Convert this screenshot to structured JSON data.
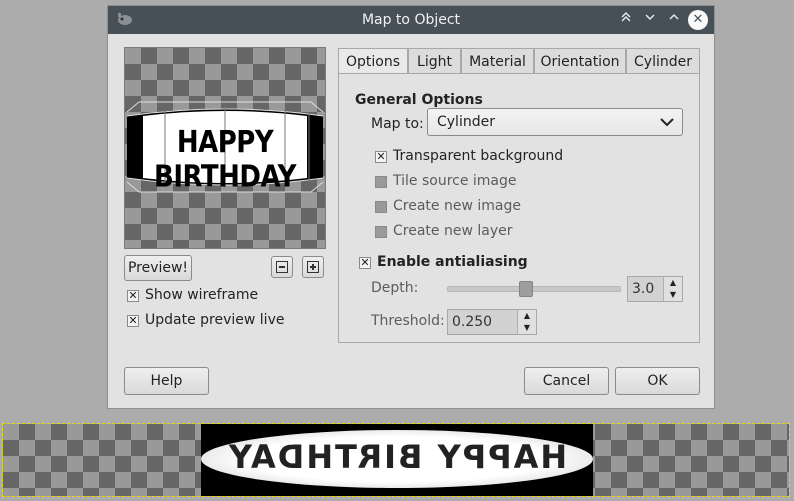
{
  "canvas": {
    "banner_text": "HAPPY BIRTHDAY"
  },
  "dialog": {
    "title": "Map to Object",
    "preview_text": "HAPPY BIRTHDAY",
    "preview_button": "Preview!",
    "show_wireframe": {
      "label": "Show wireframe",
      "checked": true
    },
    "update_preview_live": {
      "label": "Update preview live",
      "checked": true
    },
    "tabs": [
      "Options",
      "Light",
      "Material",
      "Orientation",
      "Cylinder"
    ],
    "active_tab": "Options",
    "options": {
      "section_title": "General Options",
      "map_to_label": "Map to:",
      "map_to_value": "Cylinder",
      "transparent_background": {
        "label": "Transparent background",
        "checked": true
      },
      "tile_source_image": {
        "label": "Tile source image",
        "checked": false
      },
      "create_new_image": {
        "label": "Create new image",
        "checked": false
      },
      "create_new_layer": {
        "label": "Create new layer",
        "checked": false
      },
      "enable_antialiasing": {
        "label": "Enable antialiasing",
        "checked": true
      },
      "depth_label": "Depth:",
      "depth_value": "3.0",
      "depth_slider_fraction": 0.45,
      "threshold_label": "Threshold:",
      "threshold_value": "0.250"
    },
    "buttons": {
      "help": "Help",
      "cancel": "Cancel",
      "ok": "OK"
    }
  },
  "colors": {
    "titlebar": "#475057",
    "dialog_bg": "#e2e2e2",
    "desktop_bg": "#acacac",
    "selection_outline": "#e6d700"
  }
}
